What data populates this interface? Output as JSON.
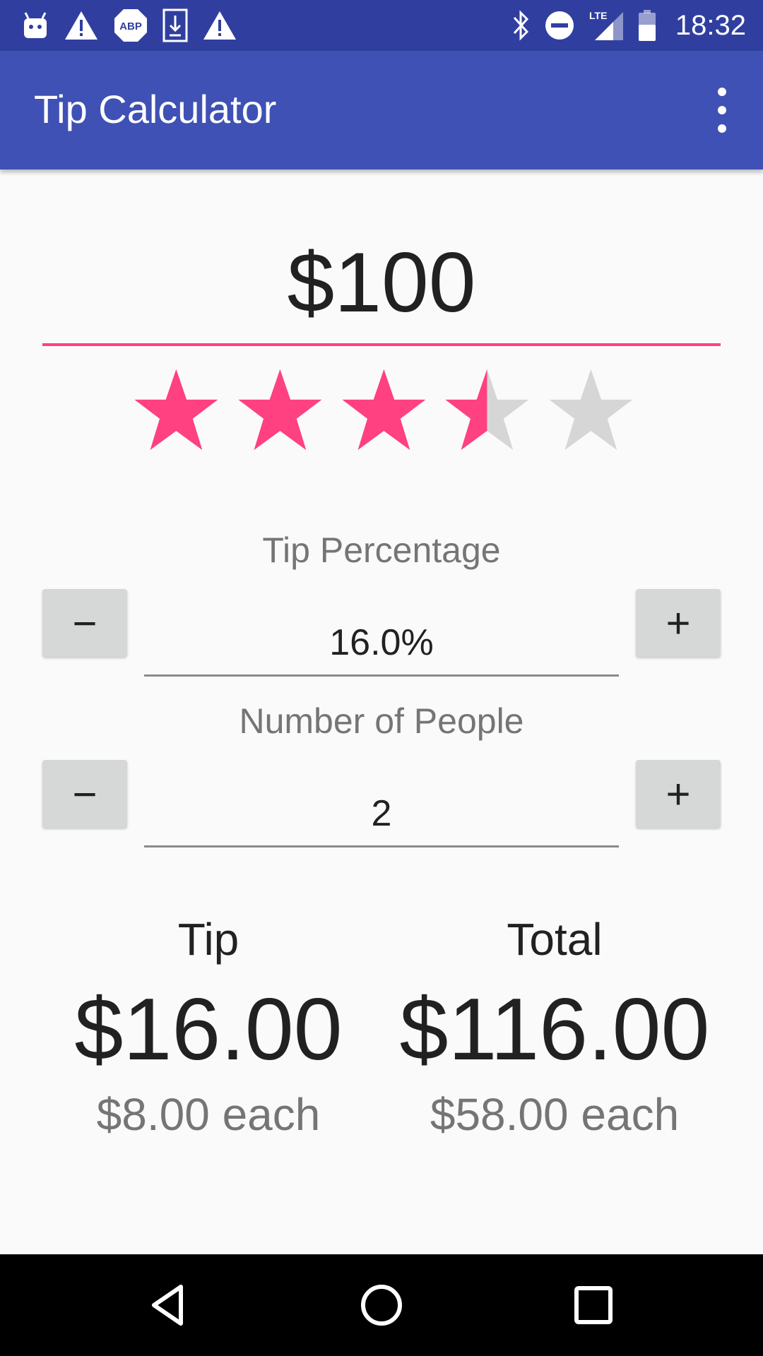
{
  "status_bar": {
    "time": "18:32",
    "left_icons": [
      "android-icon",
      "warning-icon",
      "adblock-icon",
      "download-icon",
      "warning-icon"
    ],
    "right_icons": [
      "bluetooth-icon",
      "do-not-disturb-icon",
      "lte-signal-icon",
      "battery-icon"
    ],
    "lte_label": "LTE",
    "abp_label": "ABP"
  },
  "toolbar": {
    "title": "Tip Calculator",
    "menu_icon": "overflow-menu-icon"
  },
  "bill": {
    "amount": "$100"
  },
  "rating": {
    "value": 3.5,
    "max": 5,
    "filled_color": "#ff4081",
    "empty_color": "#d6d6d6"
  },
  "tip_percentage": {
    "label": "Tip Percentage",
    "value": "16.0%",
    "decrement_label": "−",
    "increment_label": "+"
  },
  "people": {
    "label": "Number of People",
    "value": "2",
    "decrement_label": "−",
    "increment_label": "+"
  },
  "results": {
    "tip": {
      "label": "Tip",
      "amount": "$16.00",
      "each": "$8.00 each"
    },
    "total": {
      "label": "Total",
      "amount": "$116.00",
      "each": "$58.00 each"
    }
  },
  "colors": {
    "status_bar": "#303f9f",
    "toolbar": "#3f51b5",
    "accent": "#ff4081"
  },
  "nav_bar": {
    "icons": [
      "back-icon",
      "home-icon",
      "recents-icon"
    ]
  }
}
